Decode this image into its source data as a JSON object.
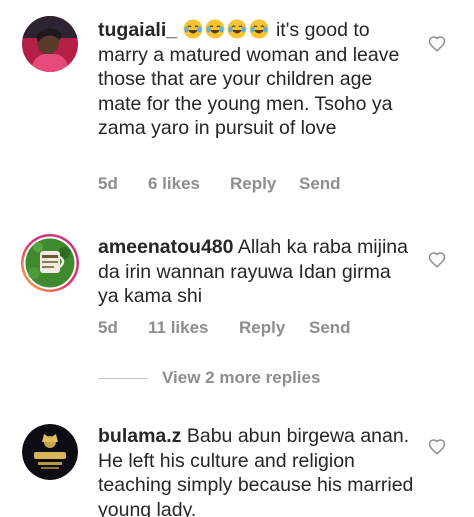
{
  "comments": [
    {
      "username": "tugaiali_",
      "emojis": [
        "laughing-tears",
        "laughing-tears",
        "laughing-tears",
        "laughing-tears"
      ],
      "text": "it's good to marry a matured woman and leave those that are your children age mate for the young men. Tsoho ya zama yaro in pursuit of love",
      "time": "5d",
      "likes": "6 likes",
      "reply_label": "Reply",
      "send_label": "Send"
    },
    {
      "username": "ameenatou480",
      "text": "Allah ka raba mijina da irin wannan rayuwa Idan girma ya kama shi",
      "time": "5d",
      "likes": "11 likes",
      "reply_label": "Reply",
      "send_label": "Send"
    },
    {
      "username": "bulama.z",
      "text": "Babu abun birgewa anan. He left his culture and religion teaching simply because his married young lady."
    }
  ],
  "replies_toggle": "View 2 more replies",
  "icons": {
    "like": "heart-outline-icon",
    "emoji": "face-with-tears-of-joy"
  },
  "colors": {
    "text": "#262626",
    "meta": "#8e8e8e",
    "emoji": "#f7c332"
  }
}
